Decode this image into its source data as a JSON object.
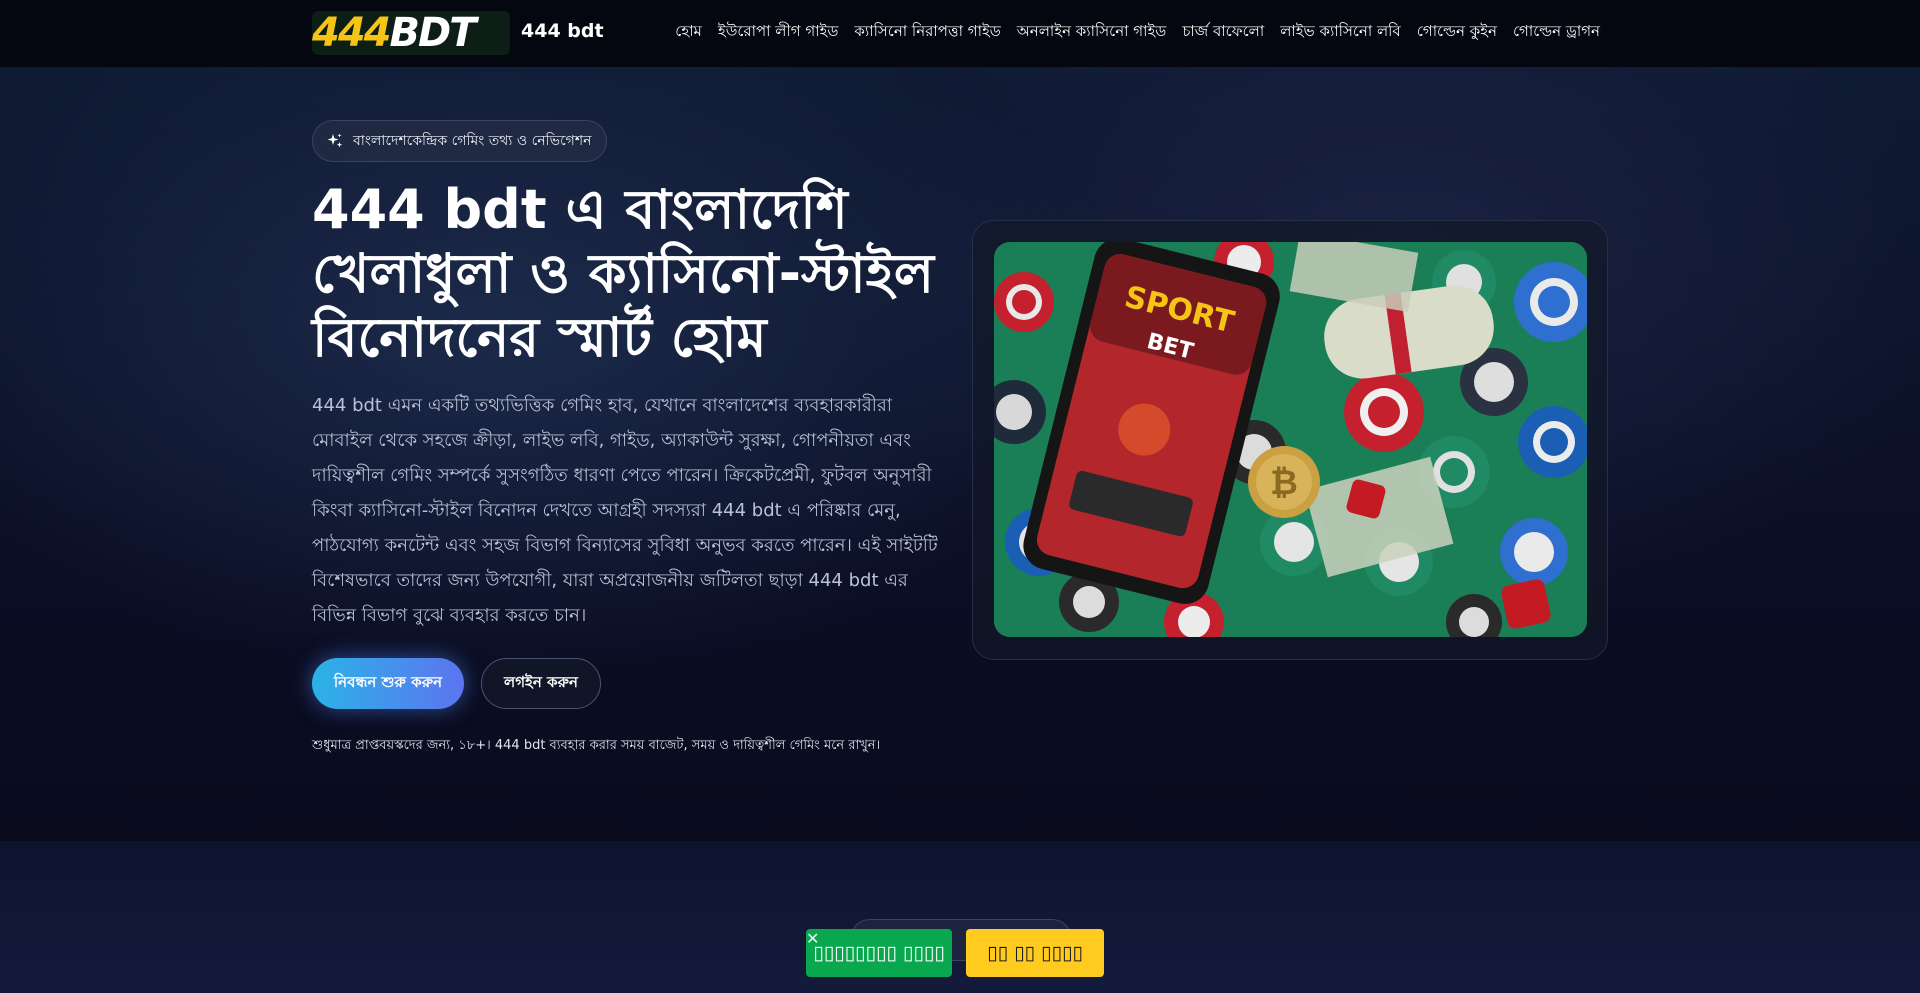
{
  "header": {
    "logo_text_yellow": "444",
    "logo_text_white": "BDT",
    "brand": "444 bdt",
    "nav": [
      "হোম",
      "ইউরোপা লীগ গাইড",
      "ক্যাসিনো নিরাপত্তা গাইড",
      "অনলাইন ক্যাসিনো গাইড",
      "চার্জ বাফেলো",
      "লাইভ ক্যাসিনো লবি",
      "গোল্ডেন কুইন",
      "গোল্ডেন ড্রাগন"
    ]
  },
  "hero": {
    "badge_icon": "sparkles-icon",
    "badge": "বাংলাদেশকেন্দ্রিক গেমিং তথ্য ও নেভিগেশন",
    "title": "444 bdt এ বাংলাদেশি খেলাধুলা ও ক্যাসিনো-স্টাইল বিনোদনের স্মার্ট হোম",
    "description": "444 bdt এমন একটি তথ্যভিত্তিক গেমিং হাব, যেখানে বাংলাদেশের ব্যবহারকারীরা মোবাইল থেকে সহজে ক্রীড়া, লাইভ লবি, গাইড, অ্যাকাউন্ট সুরক্ষা, গোপনীয়তা এবং দায়িত্বশীল গেমিং সম্পর্কে সুসংগঠিত ধারণা পেতে পারেন। ক্রিকেটপ্রেমী, ফুটবল অনুসারী কিংবা ক্যাসিনো-স্টাইল বিনোদন দেখতে আগ্রহী সদস্যরা 444 bdt এ পরিষ্কার মেনু, পাঠযোগ্য কনটেন্ট এবং সহজ বিভাগ বিন্যাসের সুবিধা অনুভব করতে পারেন। এই সাইটটি বিশেষভাবে তাদের জন্য উপযোগী, যারা অপ্রয়োজনীয় জটিলতা ছাড়া 444 bdt এর বিভিন্ন বিভাগ বুঝে ব্যবহার করতে চান।",
    "primary_button": "নিবন্ধন শুরু করুন",
    "secondary_button": "লগইন করুন",
    "note": "শুধুমাত্র প্রাপ্তবয়স্কদের জন্য, ১৮+। 444 bdt ব্যবহার করার সময় বাজেট, সময় ও দায়িত্বশীল গেমিং মনে রাখুন।",
    "image_text_sport": "SPORT",
    "image_text_bet": "BET"
  },
  "popup": {
    "green_button": "▯▯▯▯▯▯▯▯ ▯▯▯▯",
    "yellow_button": "▯▯ ▯▯ ▯▯▯▯",
    "close_icon": "close-icon"
  },
  "colors": {
    "brand_yellow": "#f5c414",
    "cta_start": "#2bb3e6",
    "cta_end": "#5c74f0",
    "popup_green": "#0aa84e",
    "popup_yellow": "#ffcb1f"
  }
}
